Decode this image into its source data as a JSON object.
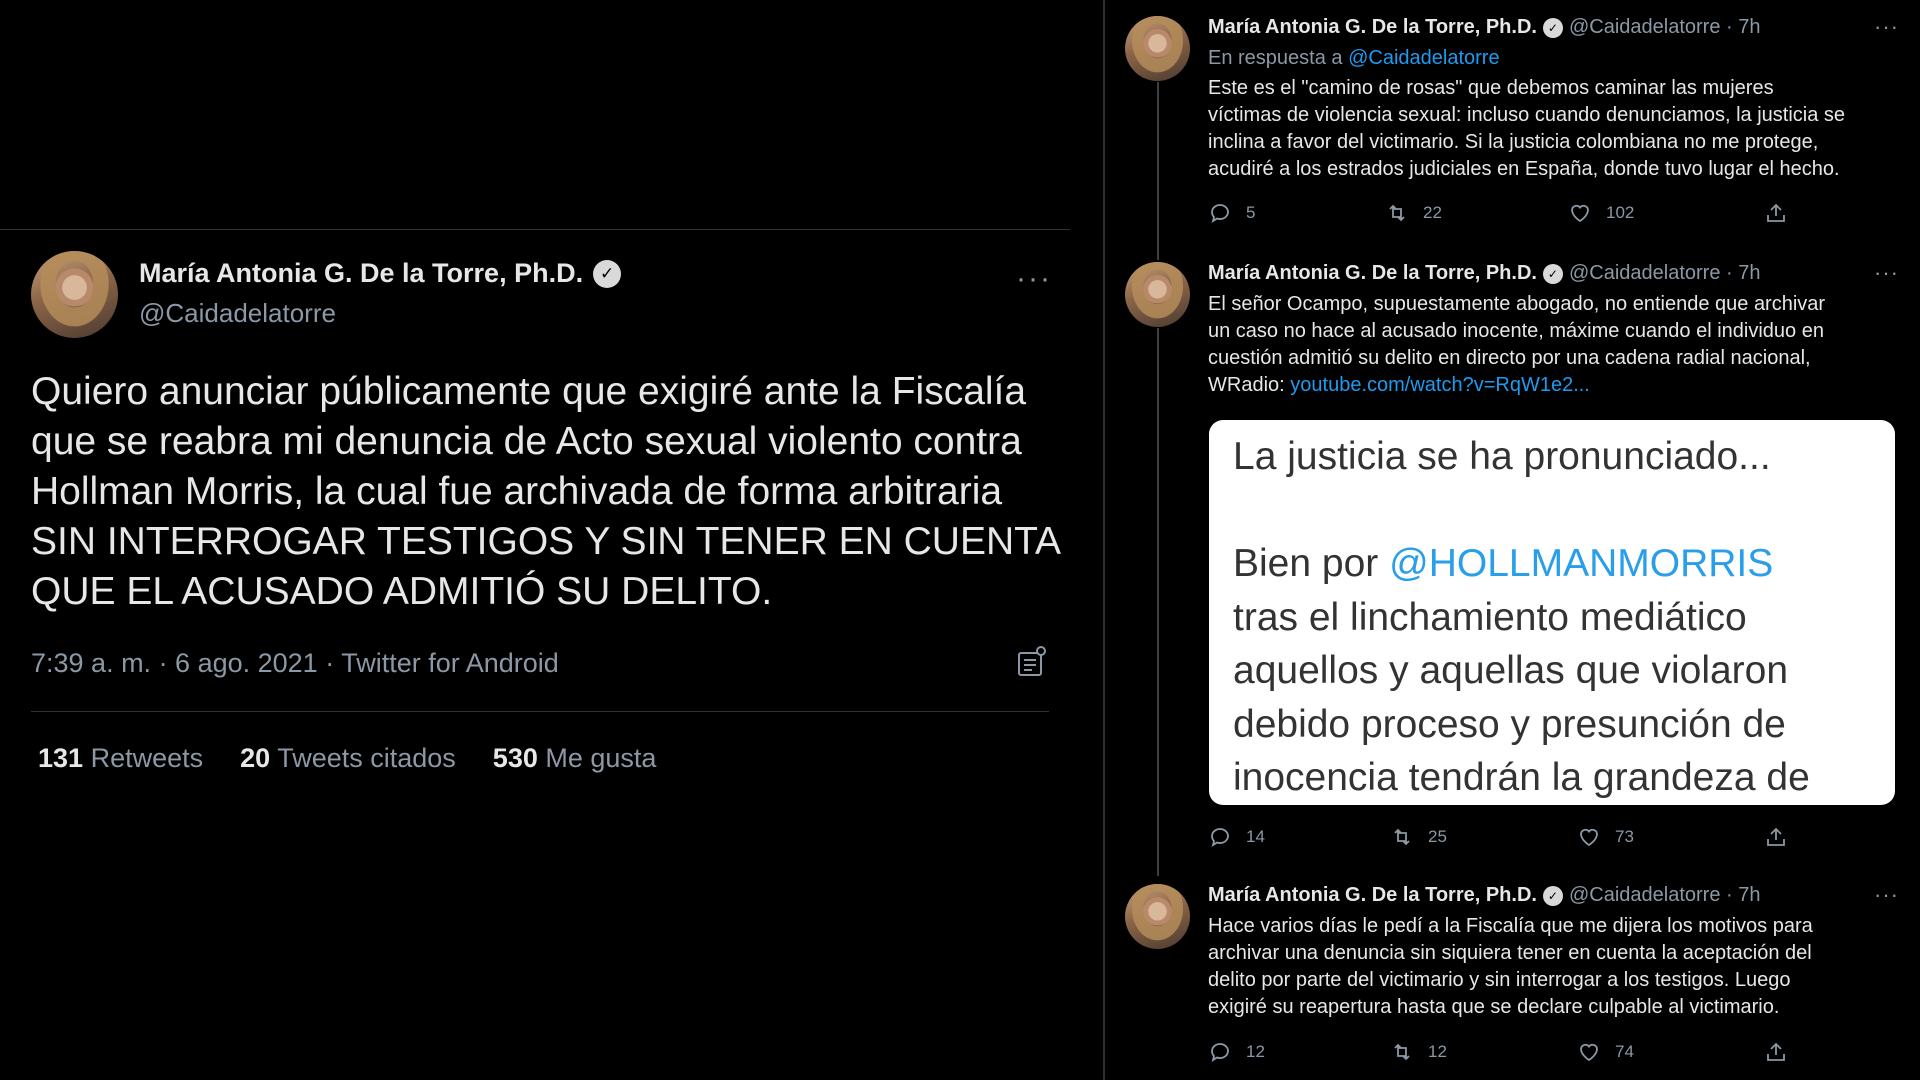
{
  "main_tweet": {
    "author_name": "María Antonia G. De la Torre, Ph.D.",
    "verified_icon": "verified-badge-icon",
    "handle": "@Caidadelatorre",
    "more_label": "···",
    "text": "Quiero anunciar públicamente que exigiré ante la Fiscalía que se reabra mi denuncia de Acto sexual violento contra Hollman Morris, la cual fue archivada de forma arbitraria SIN INTERROGAR TESTIGOS Y SIN TENER EN CUENTA QUE EL ACUSADO ADMITIÓ SU DELITO.",
    "meta": "7:39 a. m. · 6 ago. 2021 · Twitter for Android",
    "stats": {
      "retweets_count": "131",
      "retweets_label": "Retweets",
      "quotes_count": "20",
      "quotes_label": "Tweets citados",
      "likes_count": "530",
      "likes_label": "Me gusta"
    }
  },
  "thread": [
    {
      "author_name": "María Antonia G. De la Torre, Ph.D.",
      "handle_time": "@Caidadelatorre · 7h",
      "reply_prefix": "En respuesta a",
      "reply_handle": "@Caidadelatorre",
      "lines": [
        "Este es el \"camino de rosas\" que debemos caminar las mujeres",
        "víctimas de violencia sexual: incluso cuando denunciamos, la justicia se",
        "inclina a favor del victimario. Si la justicia colombiana no me protege,",
        "acudiré a los estrados judiciales en España, donde tuvo lugar el hecho."
      ],
      "replies": "5",
      "retweets": "22",
      "likes": "102"
    },
    {
      "author_name": "María Antonia G. De la Torre, Ph.D.",
      "handle_time": "@Caidadelatorre · 7h",
      "lines": [
        "El señor Ocampo, supuestamente abogado, no entiende que archivar",
        "un caso no hace al acusado inocente, máxime cuando el individuo en",
        "cuestión admitió su delito en directo por una cadena radial nacional,"
      ],
      "link_prefix": "WRadio:",
      "link": "youtube.com/watch?v=RqW1e2...",
      "media": {
        "line1": "La justicia se ha pronunciado...",
        "line2_prefix": "Bien por",
        "line2_mention": "@HOLLMANMORRIS",
        "line3": "tras el linchamiento mediático",
        "line4": "aquellos y aquellas que violaron",
        "line5": "debido proceso y presunción de",
        "line6": "inocencia tendrán la grandeza de"
      },
      "replies": "14",
      "retweets": "25",
      "likes": "73"
    },
    {
      "author_name": "María Antonia G. De la Torre, Ph.D.",
      "handle_time": "@Caidadelatorre · 7h",
      "lines": [
        "Hace varios días le pedí a la Fiscalía que me dijera los motivos para",
        "archivar una denuncia sin siquiera tener en cuenta la aceptación del",
        "delito por parte del victimario y sin interrogar a los testigos. Luego",
        "exigiré su reapertura hasta que se declare culpable al victimario."
      ],
      "replies": "12",
      "retweets": "12",
      "likes": "74"
    }
  ],
  "icons": {
    "reply": "reply-icon",
    "retweet": "retweet-icon",
    "like": "heart-icon",
    "share": "share-icon",
    "analytics": "analytics-icon",
    "more": "more-icon"
  },
  "colors": {
    "link": "#1d9bf0",
    "muted": "#8b98a5",
    "background": "#000000"
  }
}
